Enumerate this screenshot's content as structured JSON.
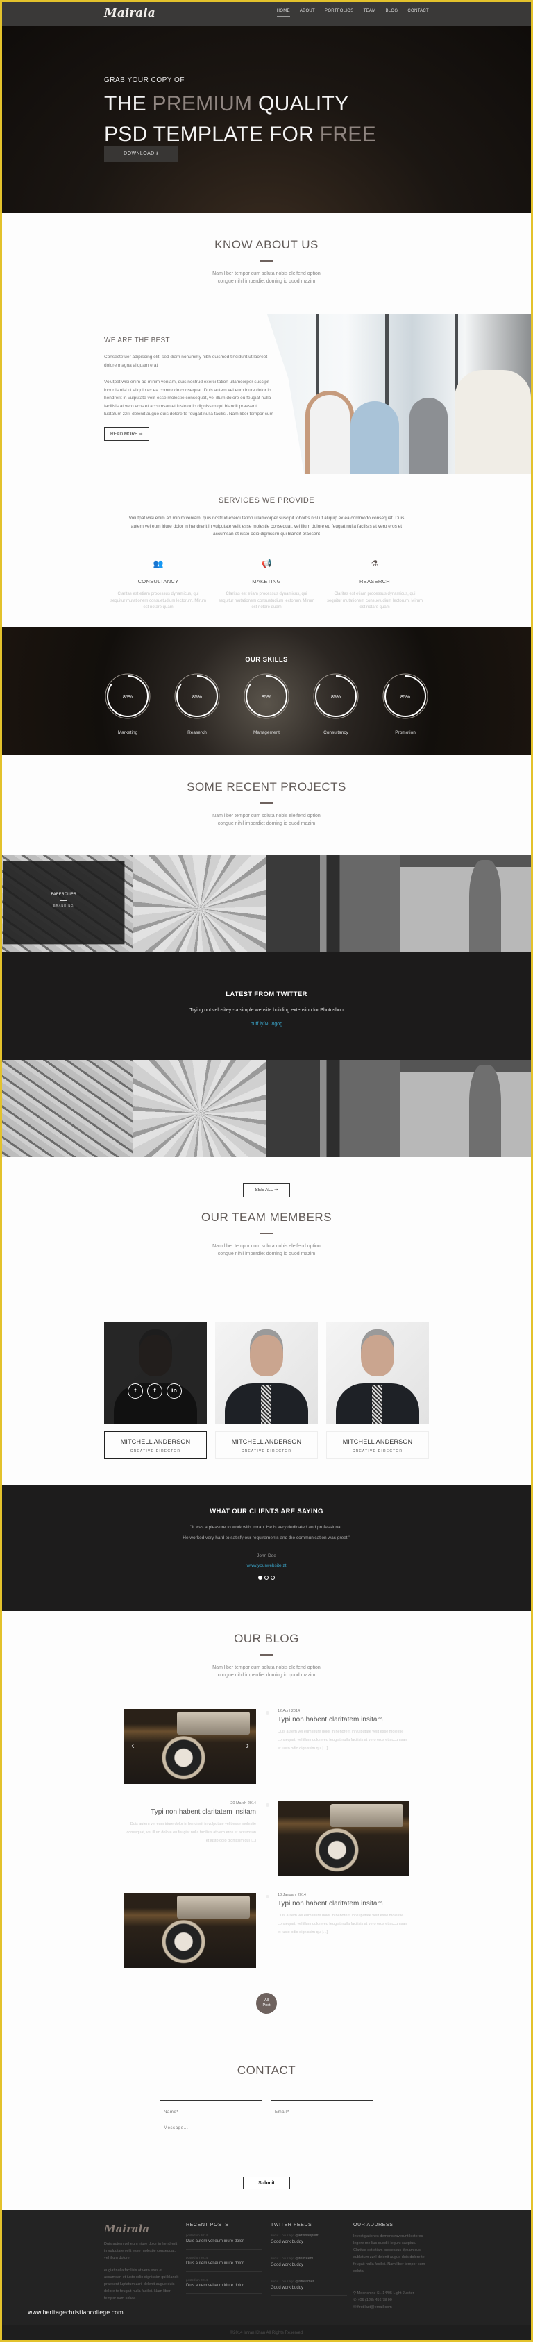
{
  "brand": {
    "logo": "Mairala",
    "accent": "#6e625e",
    "frame_color": "#e3c22c",
    "link_color": "#3aa4c8"
  },
  "nav": {
    "items": [
      {
        "label": "HOME",
        "active": true
      },
      {
        "label": "ABOUT"
      },
      {
        "label": "PORTFOLIOS"
      },
      {
        "label": "TEAM"
      },
      {
        "label": "BLOG"
      },
      {
        "label": "CONTACT"
      }
    ]
  },
  "hero": {
    "eyebrow": "GRAB YOUR COPY OF",
    "line1_a": "THE ",
    "line1_b": "PREMIUM",
    "line1_c": " QUALITY",
    "line2_a": "PSD TEMPLATE FOR ",
    "line2_b": "FREE",
    "button": "DOWNLOAD",
    "button_icon": "download-icon"
  },
  "about": {
    "title": "KNOW ABOUT US",
    "subtitle_1": "Nam liber tempor cum soluta nobis eleifend option",
    "subtitle_2": "congue nihil imperdiet doming id quod mazim",
    "heading": "WE ARE THE BEST",
    "p1": "Consectetuer adipiscing elit, sed diam nonummy nibh euismod tincidunt ut laoreet dolore magna aliquam erat",
    "p2": "Volutpat wisi enim ad minim veniam, quis nostrud exerci tation ullamcorper suscipit lobortis nisl ut aliquip ex ea commodo consequat. Duis autem vel eum iriure dolor in hendrerit in vulputate velit esse molestie consequat, vel illum dolore eu feugiat nulla facilisis at vero eros et accumsan et iusto odio dignissim qui blandit praesent luptatum zzril delenit augue duis dolore te feugait nulla facilisi. Nam liber tempor cum",
    "read_more": "READ MORE ➞"
  },
  "services": {
    "title": "SERVICES WE PROVIDE",
    "text": "Volutpat wisi enim ad minim veniam, quis nostrud exerci tation ullamcorper suscipit lobortis nisl ut aliquip ex ea commodo consequat. Duis autem vel eum iriure dolor in hendrerit in vulputate velit esse molestie consequat, vel illum dolore eu feugiat nulla facilisis at vero eros et accumsan et iusto odio dignissim qui blandit praesent",
    "items": [
      {
        "icon": "people-icon",
        "glyph": "👥",
        "title": "CONSULTANCY",
        "text": "Claritas est etiam processus dynamicus, qui sequitur mutationem consuetudium lectorum. Mirum est notare quam"
      },
      {
        "icon": "megaphone-icon",
        "glyph": "📢",
        "title": "MAKETING",
        "text": "Claritas est etiam processus dynamicus, qui sequitur mutationem consuetudium lectorum. Mirum est notare quam"
      },
      {
        "icon": "flask-icon",
        "glyph": "⚗",
        "title": "REASERCH",
        "text": "Claritas est etiam processus dynamicus, qui sequitur mutationem consuetudium lectorum. Mirum est notare quam"
      }
    ]
  },
  "skills": {
    "title": "OUR SKILLS",
    "items": [
      {
        "label": "Marketing",
        "percent": 85,
        "text": "85%"
      },
      {
        "label": "Reaserch",
        "percent": 85,
        "text": "85%"
      },
      {
        "label": "Management",
        "percent": 85,
        "text": "85%"
      },
      {
        "label": "Consultancy",
        "percent": 85,
        "text": "85%"
      },
      {
        "label": "Promotion",
        "percent": 85,
        "text": "85%"
      }
    ]
  },
  "projects": {
    "title": "SOME RECENT PROJECTS",
    "subtitle_1": "Nam liber tempor cum soluta nobis eleifend option",
    "subtitle_2": "congue nihil imperdiet doming id quod mazim",
    "overlay_title": "PAPERCLIPS",
    "overlay_category": "BRANDING",
    "see_all": "SEE ALL ➞"
  },
  "twitter": {
    "title": "LATEST FROM TWITTER",
    "tweet": "Trying out velositey - a simple website building extension for Photoshop",
    "link": "buff.ly/NC8gog"
  },
  "team": {
    "title": "OUR TEAM MEMBERS",
    "subtitle_1": "Nam liber tempor cum soluta nobis eleifend option",
    "subtitle_2": "congue nihil imperdiet doming id quod mazim",
    "members": [
      {
        "name": "MITCHELL ANDERSON",
        "role": "CREATIVE DIRECTOR"
      },
      {
        "name": "MITCHELL ANDERSON",
        "role": "CREATIVE DIRECTOR"
      },
      {
        "name": "MITCHELL ANDERSON",
        "role": "CREATIVE DIRECTOR"
      }
    ],
    "socials": [
      {
        "icon": "twitter-icon",
        "glyph": "t"
      },
      {
        "icon": "facebook-icon",
        "glyph": "f"
      },
      {
        "icon": "linkedin-icon",
        "glyph": "in"
      }
    ]
  },
  "clients": {
    "title": "WHAT OUR CLIENTS ARE SAYING",
    "quote_1": "\"It was a pleasure to work with Imran. He is very dedicated and professional.",
    "quote_2": "He worked very hard to satisfy our requirements and the communication was great.\"",
    "name": "John Doe",
    "website": "www.yourwebsite.zt",
    "active_slide": 1,
    "slides": 3
  },
  "blog": {
    "title": "OUR BLOG",
    "subtitle_1": "Nam liber tempor cum soluta nobis eleifend option",
    "subtitle_2": "congue nihil imperdiet doming id quod mazim",
    "posts": [
      {
        "date": "12 April 2014",
        "title": "Typi non habent claritatem insitam",
        "text": "Duis autem vel eum iriure dolor in hendrerit in vulputate velit esse molestie consequat, vel illum dolore eu feugiat nulla facilisis at vero eros et accumsan et iusto odio dignissim qui [...]"
      },
      {
        "date": "20 March 2014",
        "title": "Typi non habent claritatem insitam",
        "text": "Duis autem vel eum iriure dolor in hendrerit in vulputate velit esse molestie consequat, vel illum dolore eu feugiat nulla facilisis at vero eros et accumsan et iusto odio dignissim qui [...]"
      },
      {
        "date": "18 January 2014",
        "title": "Typi non habent claritatem insitam",
        "text": "Duis autem vel eum iriure dolor in hendrerit in vulputate velit esse molestie consequat, vel illum dolore eu feugiat nulla facilisis at vero eros et accumsan et iusto odio dignissim qui [...]"
      }
    ],
    "all_post_1": "All",
    "all_post_2": "Post"
  },
  "contact": {
    "title": "CONTACT",
    "name_placeholder": "Name*",
    "email_placeholder": "Email*",
    "message_placeholder": "Message...",
    "submit": "Submit"
  },
  "footer": {
    "about_1": "Duis autem vel eum iriure dolor in hendrerit in vulputate velit esse molestie consequat, vel illum dolore.",
    "about_2": "eugiat nulla facilisis at vero eros et accumsan et iusto odio dignissim qui blandit praesent luptatum zzril delenit augue duis dolore te feugait nulla facilisi. Nam liber tempor cum soluta",
    "recent_title": "RECENT POSTS",
    "recent": [
      {
        "meta": "posted on 2014",
        "title": "Duis autem vel eum iriure dolor"
      },
      {
        "meta": "posted on 2014",
        "title": "Duis autem vel eum iriure dolor"
      },
      {
        "meta": "posted on 2014",
        "title": "Duis autem vel eum iriure dolor"
      }
    ],
    "twitter_title": "TWITER FEEDS",
    "tweets": [
      {
        "meta": "about 1 hour ago",
        "handle": "@kristianpiatt",
        "text": "Good work buddy"
      },
      {
        "meta": "about 1 hour ago",
        "handle": "@felixeem",
        "text": "Good work buddy"
      },
      {
        "meta": "about 1 hour ago",
        "handle": "@streamer",
        "text": "Good work buddy"
      }
    ],
    "address_title": "OUR ADDRESS",
    "address_text": "Investigationes demonstraverunt lectores legere me lius quod ii legunt saepius. Claritas est etiam processus dynamicus sublatum zzril delenit augue duis dolore te feugait nulla facilisi. Nam liber tempor cum soluta",
    "street": "Moonshine St. 14/05 Light Jupiter",
    "phone": "+05 (123) 456 78 90",
    "email": "first.last@email.com",
    "copyright": "©2014 Imran Khan All Rights Reserved"
  },
  "watermark": "www.heritagechristiancollege.com"
}
